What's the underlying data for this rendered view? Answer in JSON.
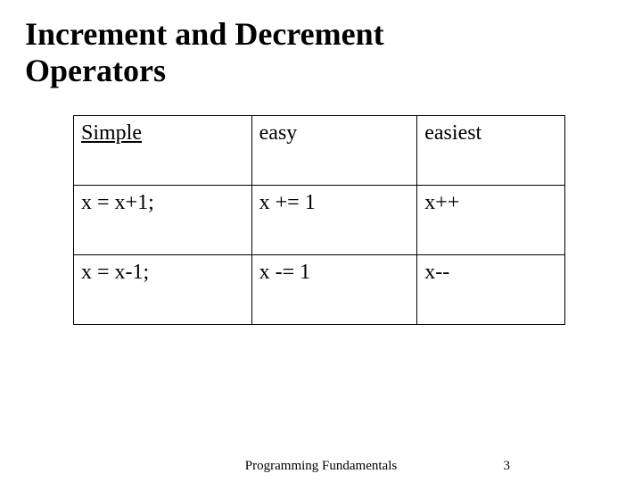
{
  "title_line1": "Increment and Decrement",
  "title_line2": "Operators",
  "chart_data": {
    "type": "table",
    "headers": [
      "Simple",
      "easy",
      "easiest"
    ],
    "rows": [
      [
        "x = x+1;",
        "x += 1",
        "x++"
      ],
      [
        "x = x-1;",
        "x -= 1",
        "x--"
      ]
    ]
  },
  "footer_label": "Programming Fundamentals",
  "footer_page": "3"
}
